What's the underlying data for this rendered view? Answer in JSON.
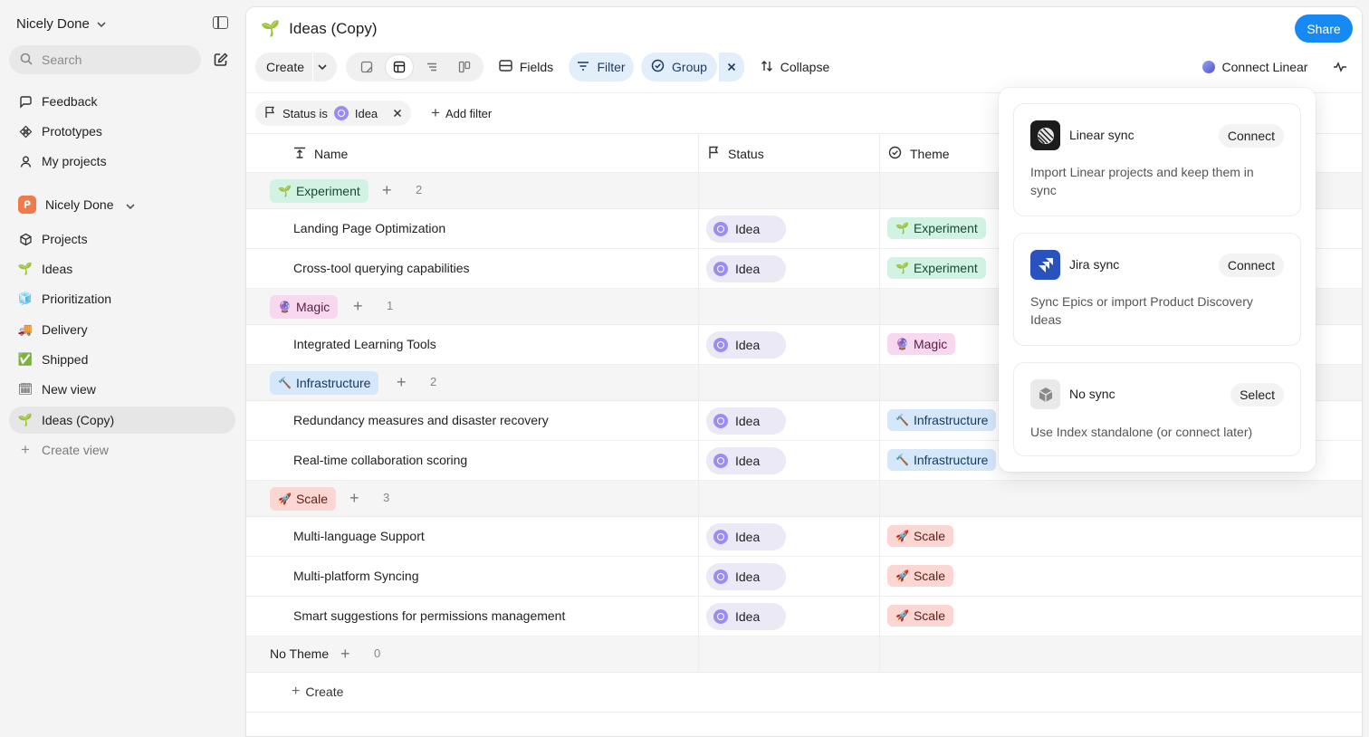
{
  "sidebar": {
    "workspace_name": "Nicely Done",
    "search_placeholder": "Search",
    "top_items": [
      {
        "label": "Feedback",
        "icon": "feedback-icon"
      },
      {
        "label": "Prototypes",
        "icon": "prototypes-icon"
      },
      {
        "label": "My projects",
        "icon": "person-icon"
      }
    ],
    "team_name": "Nicely Done",
    "team_items": [
      {
        "label": "Projects",
        "icon": "cube-icon"
      },
      {
        "label": "Ideas",
        "icon": "seedling-icon"
      },
      {
        "label": "Prioritization",
        "icon": "cube-blue-icon"
      },
      {
        "label": "Delivery",
        "icon": "truck-icon"
      },
      {
        "label": "Shipped",
        "icon": "check-box-icon"
      },
      {
        "label": "New view",
        "icon": "calendar-icon"
      },
      {
        "label": "Ideas (Copy)",
        "icon": "seedling-icon",
        "active": true
      },
      {
        "label": "Create view",
        "icon": "plus-icon",
        "muted": true
      }
    ]
  },
  "header": {
    "title": "Ideas (Copy)",
    "share_label": "Share"
  },
  "toolbar": {
    "create_label": "Create",
    "fields_label": "Fields",
    "filter_label": "Filter",
    "group_label": "Group",
    "collapse_label": "Collapse",
    "connect_linear_label": "Connect Linear"
  },
  "filters": {
    "status_prefix": "Status is",
    "status_value": "Idea",
    "add_filter_label": "Add filter"
  },
  "table": {
    "columns": {
      "name": "Name",
      "status": "Status",
      "theme": "Theme"
    },
    "groups": [
      {
        "label": "Experiment",
        "style": "exp",
        "emoji": "🌱",
        "count": "2",
        "rows": [
          {
            "name": "Landing Page Optimization",
            "status": "Idea",
            "theme": "Experiment"
          },
          {
            "name": "Cross-tool querying capabilities",
            "status": "Idea",
            "theme": "Experiment"
          }
        ]
      },
      {
        "label": "Magic",
        "style": "mag",
        "emoji": "🔮",
        "count": "1",
        "rows": [
          {
            "name": "Integrated Learning Tools",
            "status": "Idea",
            "theme": "Magic"
          }
        ]
      },
      {
        "label": "Infrastructure",
        "style": "inf",
        "emoji": "🔨",
        "count": "2",
        "rows": [
          {
            "name": "Redundancy measures and disaster recovery",
            "status": "Idea",
            "theme": "Infrastructure"
          },
          {
            "name": "Real-time collaboration scoring",
            "status": "Idea",
            "theme": "Infrastructure"
          }
        ]
      },
      {
        "label": "Scale",
        "style": "scl",
        "emoji": "🚀",
        "count": "3",
        "rows": [
          {
            "name": "Multi-language Support",
            "status": "Idea",
            "theme": "Scale"
          },
          {
            "name": "Multi-platform Syncing",
            "status": "Idea",
            "theme": "Scale"
          },
          {
            "name": "Smart suggestions for permissions management",
            "status": "Idea",
            "theme": "Scale"
          }
        ]
      },
      {
        "label": "No Theme",
        "style": "none",
        "emoji": "",
        "count": "0",
        "rows": []
      }
    ],
    "create_label": "Create"
  },
  "popover": {
    "cards": [
      {
        "title": "Linear sync",
        "button": "Connect",
        "description": "Import Linear projects and keep them in sync",
        "icon": "linear-logo-icon"
      },
      {
        "title": "Jira sync",
        "button": "Connect",
        "description": "Sync Epics or import Product Discovery Ideas",
        "icon": "jira-logo-icon"
      },
      {
        "title": "No sync",
        "button": "Select",
        "description": "Use Index standalone (or connect later)",
        "icon": "box-icon"
      }
    ]
  },
  "colors": {
    "accent": "#1689f5",
    "experiment_bg": "#d2f3e4",
    "magic_bg": "#f8d8ee",
    "infrastructure_bg": "#d5e7fb",
    "scale_bg": "#fbd6d2",
    "idea_status": "#9a8cf2"
  }
}
